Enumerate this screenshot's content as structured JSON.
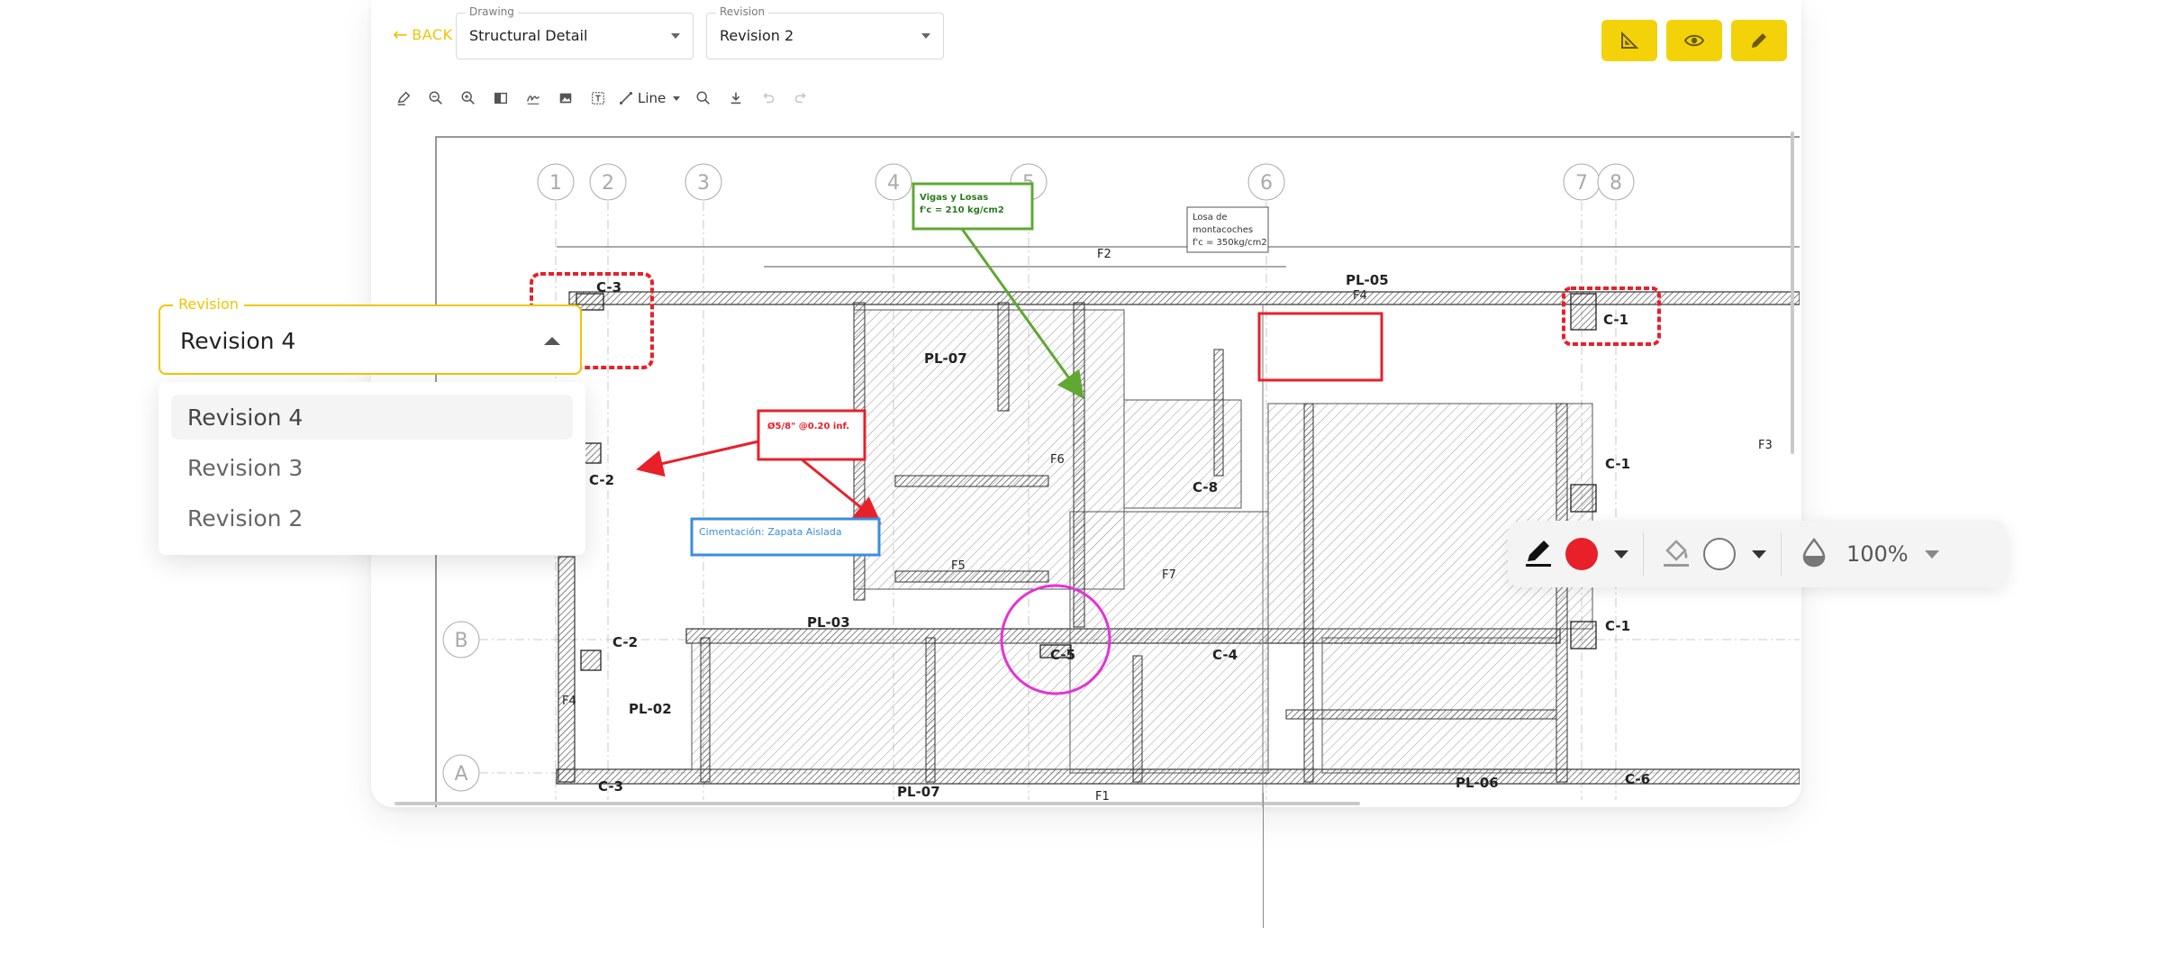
{
  "header": {
    "back_label": "BACK",
    "drawing_field": {
      "legend": "Drawing",
      "value": "Structural Detail"
    },
    "revision_field": {
      "legend": "Revision",
      "value": "Revision 2"
    }
  },
  "mode_buttons": [
    {
      "name": "measure-icon"
    },
    {
      "name": "eye-icon"
    },
    {
      "name": "pencil-icon"
    }
  ],
  "toolbar": {
    "line_tool_label": "Line"
  },
  "drawing": {
    "grid_labels": [
      "1",
      "2",
      "3",
      "4",
      "5",
      "6",
      "7",
      "8",
      "B",
      "A"
    ],
    "texts": {
      "pl05": "PL-05",
      "pl07a": "PL-07",
      "pl03": "PL-03",
      "pl02": "PL-02",
      "pl07b": "PL-07",
      "pl06": "PL-06",
      "c1a": "C-1",
      "c1b": "C-1",
      "c1c": "C-1",
      "c2a": "C-2",
      "c2b": "C-2",
      "c3a": "C-3",
      "c3b": "C-3",
      "c4": "C-4",
      "c5": "C-5",
      "c6": "C-6",
      "c8": "C-8",
      "losa1": "Losa de",
      "losa2": "montacoches",
      "losa3": "f'c = 350kg/cm2",
      "f1": "F1",
      "f2": "F2",
      "f3": "F3",
      "f4a": "F4",
      "f4b": "F4",
      "f5": "F5",
      "f6": "F6",
      "f7": "F7"
    },
    "annotations": {
      "green_note_line1": "Vigas y Losas",
      "green_note_line2": "f'c = 210 kg/cm2",
      "red_note": "Ø5/8\" @0.20 inf.",
      "blue_note": "Cimentación: Zapata Aislada"
    },
    "colors": {
      "green": "#5fa832",
      "red": "#e8202a",
      "blue": "#3a8de0",
      "magenta": "#e433d8"
    }
  },
  "revision_dropdown": {
    "legend": "Revision",
    "value": "Revision 4",
    "options": [
      {
        "label": "Revision 4",
        "selected": true
      },
      {
        "label": "Revision 3",
        "selected": false
      },
      {
        "label": "Revision 2",
        "selected": false
      }
    ]
  },
  "style_toolbar": {
    "stroke_icon": "pen-icon",
    "stroke_color": "#e8202a",
    "fill_icon": "fill-bucket-icon",
    "fill_color": "#ffffff",
    "opacity_icon": "drop-icon",
    "opacity_value": "100%"
  },
  "theme": {
    "accent": "#f3d20a",
    "accent_text": "#f0c400"
  }
}
